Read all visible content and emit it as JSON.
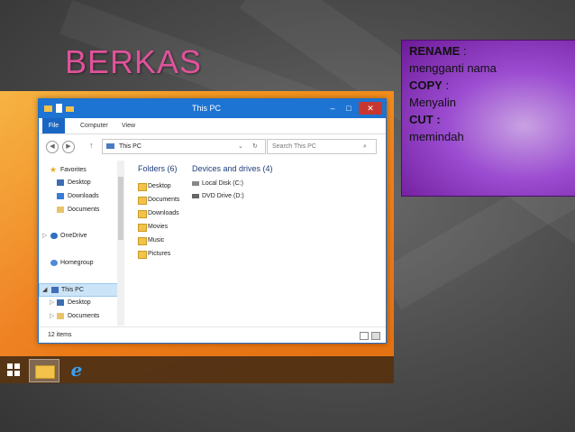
{
  "slide": {
    "title": "BERKAS",
    "colors": {
      "title": "#e0529a",
      "panel": "#9b4cd0",
      "desktop": "#ef7f1a",
      "window_accent": "#1e74d2"
    }
  },
  "panel": {
    "rename_term": "RENAME",
    "rename_sep": " :",
    "rename_desc": " mengganti nama",
    "copy_term": "COPY",
    "copy_sep": " :",
    "copy_desc": "Menyalin",
    "cut_term": "CUT :",
    "cut_desc": "memindah"
  },
  "explorer": {
    "window_title": "This PC",
    "controls": {
      "minimize": "–",
      "maximize": "□",
      "close": "✕"
    },
    "ribbon_tabs": [
      "File",
      "Computer",
      "View"
    ],
    "address": "This PC",
    "search_placeholder": "Search This PC",
    "nav": {
      "favorites": "Favorites",
      "desktop": "Desktop",
      "downloads": "Downloads",
      "documents": "Documents",
      "onedrive": "OneDrive",
      "homegroup": "Homegroup",
      "thispc": "This PC",
      "pc_desktop": "Desktop",
      "pc_documents": "Documents"
    },
    "folders_header": "Folders (6)",
    "folders": [
      "Desktop",
      "Documents",
      "Downloads",
      "Movies",
      "Music",
      "Pictures"
    ],
    "devices_header": "Devices and drives (4)",
    "devices": [
      "Local Disk (C:)",
      "DVD Drive (D:)"
    ],
    "status_count": "12 items"
  },
  "taskbar": {
    "icons": [
      "windows-start-icon",
      "file-explorer-icon",
      "internet-explorer-icon"
    ],
    "ie_glyph": "e"
  }
}
